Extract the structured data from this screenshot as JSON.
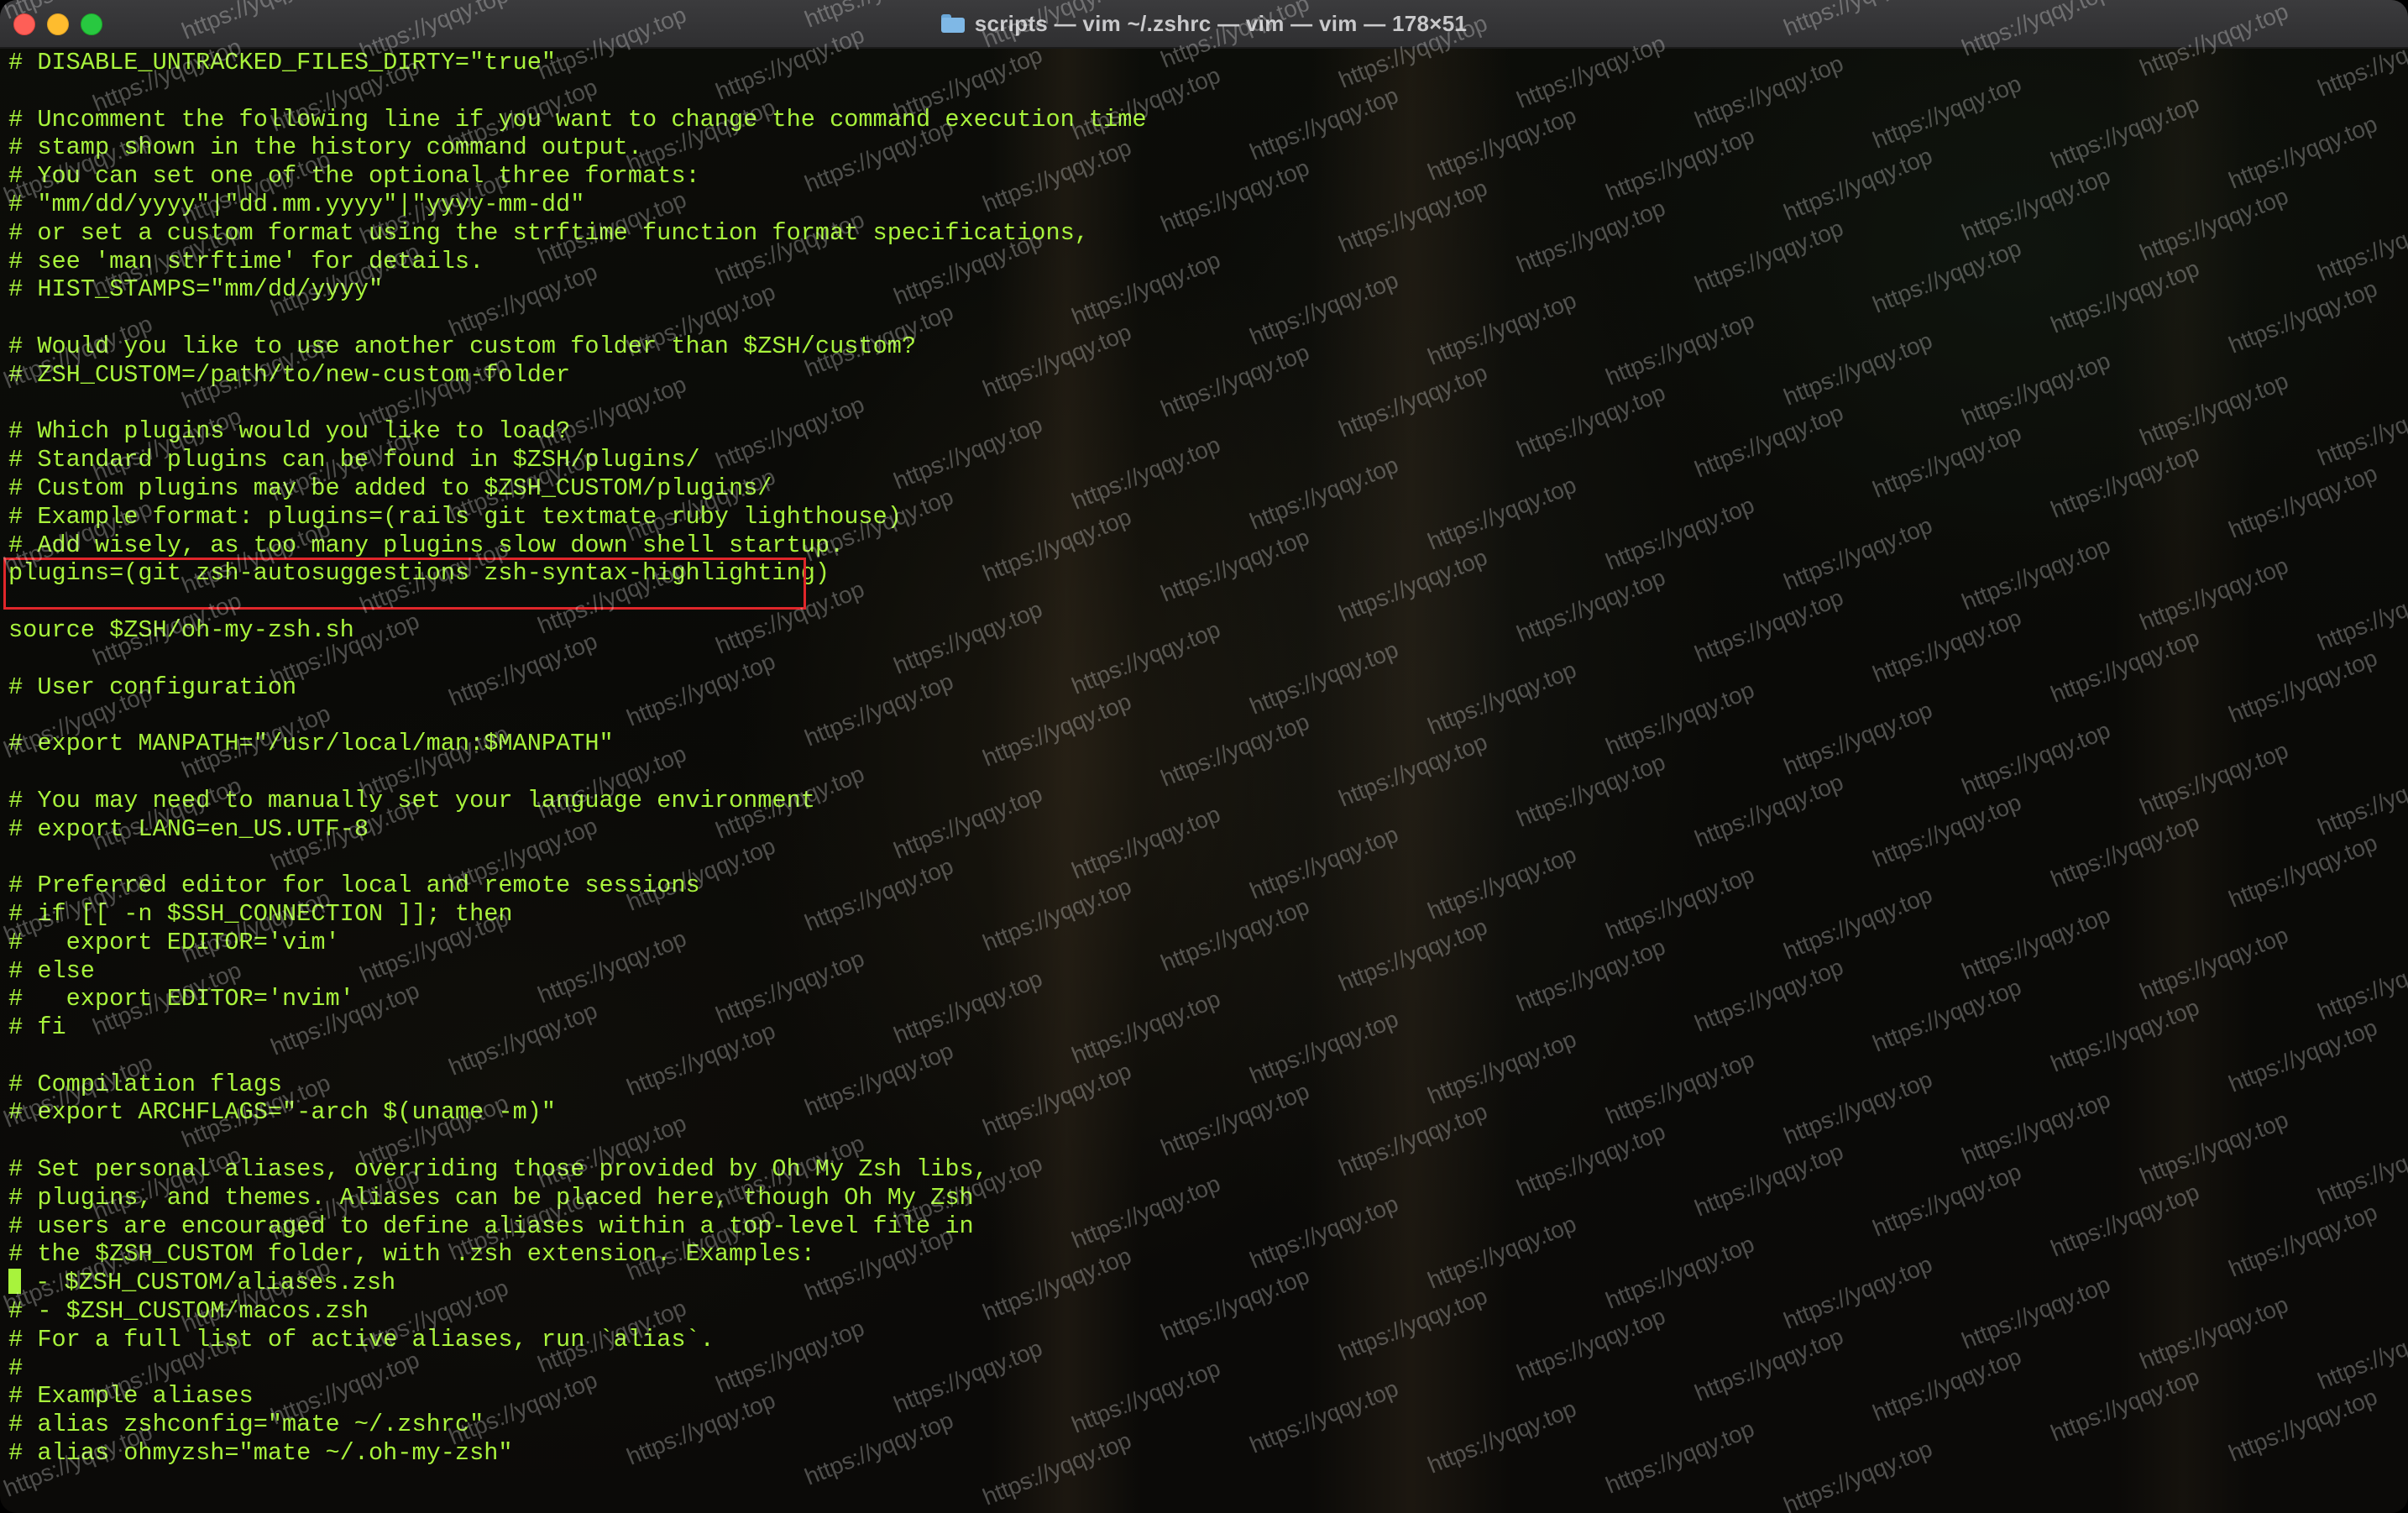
{
  "window": {
    "title": "scripts — vim ~/.zshrc — vim — vim — 178×51",
    "icon": "folder-icon"
  },
  "terminal": {
    "lines": [
      "# DISABLE_UNTRACKED_FILES_DIRTY=\"true\"",
      "",
      "# Uncomment the following line if you want to change the command execution time",
      "# stamp shown in the history command output.",
      "# You can set one of the optional three formats:",
      "# \"mm/dd/yyyy\"|\"dd.mm.yyyy\"|\"yyyy-mm-dd\"",
      "# or set a custom format using the strftime function format specifications,",
      "# see 'man strftime' for details.",
      "# HIST_STAMPS=\"mm/dd/yyyy\"",
      "",
      "# Would you like to use another custom folder than $ZSH/custom?",
      "# ZSH_CUSTOM=/path/to/new-custom-folder",
      "",
      "# Which plugins would you like to load?",
      "# Standard plugins can be found in $ZSH/plugins/",
      "# Custom plugins may be added to $ZSH_CUSTOM/plugins/",
      "# Example format: plugins=(rails git textmate ruby lighthouse)",
      "# Add wisely, as too many plugins slow down shell startup.",
      "plugins=(git zsh-autosuggestions zsh-syntax-highlighting)",
      "",
      "source $ZSH/oh-my-zsh.sh",
      "",
      "# User configuration",
      "",
      "# export MANPATH=\"/usr/local/man:$MANPATH\"",
      "",
      "# You may need to manually set your language environment",
      "# export LANG=en_US.UTF-8",
      "",
      "# Preferred editor for local and remote sessions",
      "# if [[ -n $SSH_CONNECTION ]]; then",
      "#   export EDITOR='vim'",
      "# else",
      "#   export EDITOR='nvim'",
      "# fi",
      "",
      "# Compilation flags",
      "# export ARCHFLAGS=\"-arch $(uname -m)\"",
      "",
      "# Set personal aliases, overriding those provided by Oh My Zsh libs,",
      "# plugins, and themes. Aliases can be placed here, though Oh My Zsh",
      "# users are encouraged to define aliases within a top-level file in",
      "# the $ZSH_CUSTOM folder, with .zsh extension. Examples:",
      " - $ZSH_CUSTOM/aliases.zsh",
      "# - $ZSH_CUSTOM/macos.zsh",
      "# For a full list of active aliases, run `alias`.",
      "#",
      "# Example aliases",
      "# alias zshconfig=\"mate ~/.zshrc\"",
      "# alias ohmyzsh=\"mate ~/.oh-my-zsh\""
    ],
    "cursor_line": 43,
    "highlighted_line": 18
  },
  "watermark": "https://yqqy.top",
  "colors": {
    "text": "#a8f33c",
    "highlight_border": "#e0262a",
    "titlebar": "#323234"
  }
}
